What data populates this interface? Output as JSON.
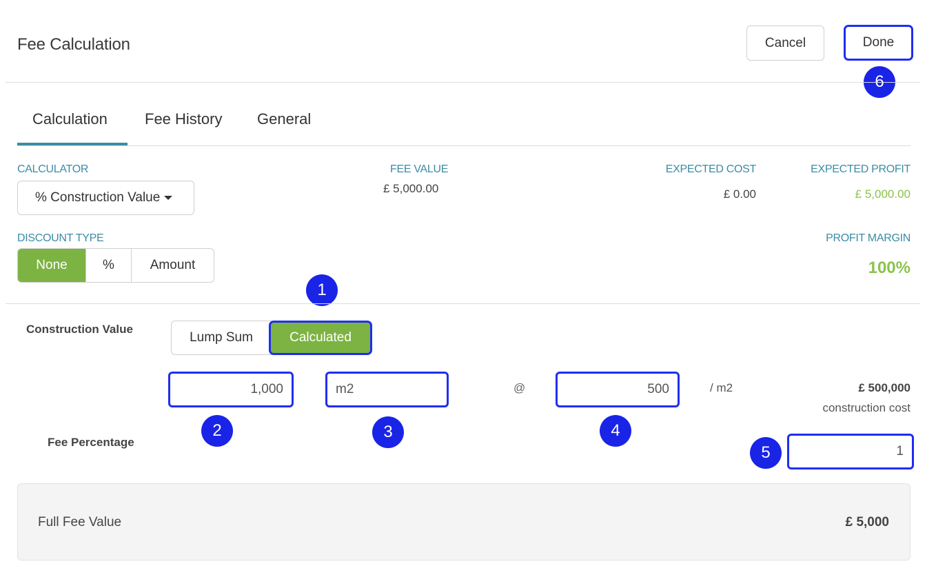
{
  "header": {
    "title": "Fee Calculation",
    "cancel_label": "Cancel",
    "done_label": "Done"
  },
  "tabs": [
    "Calculation",
    "Fee History",
    "General"
  ],
  "calculator": {
    "label": "CALCULATOR",
    "selected": "% Construction Value"
  },
  "fee_value": {
    "label": "FEE VALUE",
    "value": "£ 5,000.00"
  },
  "expected_cost": {
    "label": "EXPECTED COST",
    "value": "£ 0.00"
  },
  "expected_profit": {
    "label": "EXPECTED PROFIT",
    "value": "£ 5,000.00"
  },
  "discount": {
    "label": "DISCOUNT TYPE",
    "options": [
      "None",
      "%",
      "Amount"
    ],
    "selected": "None"
  },
  "profit_margin": {
    "label": "PROFIT MARGIN",
    "value": "100%"
  },
  "construction": {
    "label": "Construction Value",
    "modes": [
      "Lump Sum",
      "Calculated"
    ],
    "selected_mode": "Calculated",
    "quantity": "1,000",
    "unit": "m2",
    "at_symbol": "@",
    "rate": "500",
    "per_unit": "/ m2",
    "total": "£ 500,000",
    "total_caption": "construction cost"
  },
  "fee_percentage": {
    "label": "Fee Percentage",
    "value": "1"
  },
  "full_fee": {
    "label": "Full Fee Value",
    "value": "£ 5,000"
  },
  "annotations": [
    "1",
    "2",
    "3",
    "4",
    "5",
    "6"
  ],
  "colors": {
    "accent": "#3a8ca5",
    "active_green": "#7cb342",
    "profit_green": "#8bc34a",
    "highlight_blue": "#1f2ef0"
  }
}
